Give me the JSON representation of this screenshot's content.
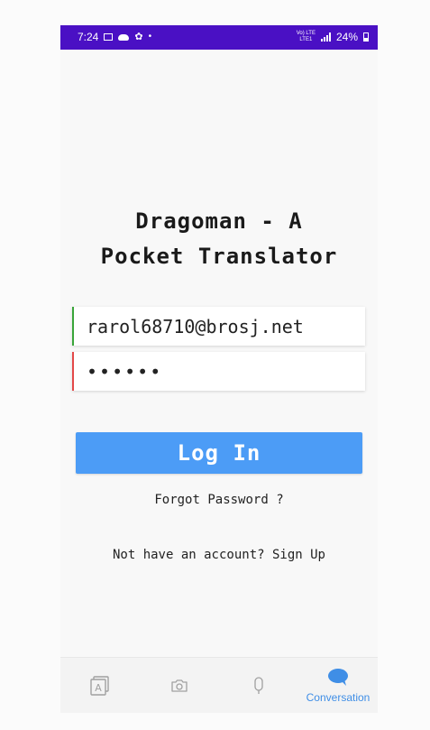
{
  "status_bar": {
    "time": "7:24",
    "network": "Vo) LTE\nLTE1",
    "battery": "24%",
    "icons": [
      "image-icon",
      "cloud-icon",
      "gear-icon",
      "dot-icon",
      "lte-icon",
      "signal-icon",
      "battery-icon"
    ]
  },
  "app": {
    "title_line1": "Dragoman - A",
    "title_line2": "Pocket Translator"
  },
  "login_form": {
    "email_value": "rarol68710@brosj.net",
    "password_value": "••••••",
    "login_label": "Log In",
    "forgot_label": "Forgot Password ?",
    "signup_label": "Not have an account? Sign Up"
  },
  "bottom_nav": {
    "items": [
      {
        "icon": "text-translate-icon",
        "label": ""
      },
      {
        "icon": "camera-icon",
        "label": ""
      },
      {
        "icon": "microphone-icon",
        "label": ""
      },
      {
        "icon": "chat-bubble-icon",
        "label": "Conversation"
      }
    ],
    "active_index": 3
  },
  "colors": {
    "status_bar": "#4a10c4",
    "accent": "#4c9cf6",
    "active_nav": "#3f8ee6",
    "email_border": "#3aa53a",
    "password_border": "#e34848"
  }
}
